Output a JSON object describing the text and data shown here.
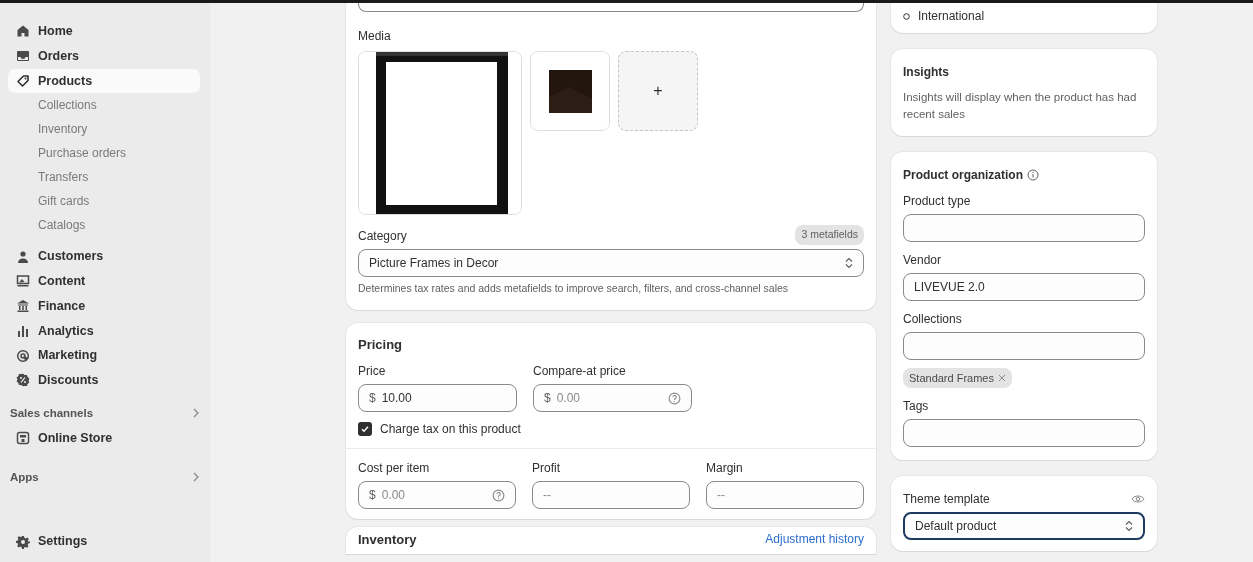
{
  "sidebar": {
    "items": [
      {
        "label": "Home",
        "selected": false
      },
      {
        "label": "Orders",
        "selected": false
      },
      {
        "label": "Products",
        "selected": true,
        "children": [
          {
            "label": "Collections"
          },
          {
            "label": "Inventory"
          },
          {
            "label": "Purchase orders"
          },
          {
            "label": "Transfers"
          },
          {
            "label": "Gift cards"
          },
          {
            "label": "Catalogs"
          }
        ]
      },
      {
        "label": "Customers",
        "selected": false
      },
      {
        "label": "Content",
        "selected": false
      },
      {
        "label": "Finance",
        "selected": false
      },
      {
        "label": "Analytics",
        "selected": false
      },
      {
        "label": "Marketing",
        "selected": false
      },
      {
        "label": "Discounts",
        "selected": false
      }
    ],
    "sections": [
      {
        "title": "Sales channels",
        "items": [
          {
            "label": "Online Store",
            "selected": false
          }
        ]
      },
      {
        "title": "Apps"
      }
    ],
    "settings": {
      "label": "Settings"
    }
  },
  "main": {
    "media": {
      "title": "Media",
      "items": [
        {
          "kind": "picture"
        },
        {
          "kind": "picture"
        },
        {
          "kind": "add",
          "label": "+"
        }
      ],
      "category": {
        "label": "Category",
        "badge": "3 metafields",
        "value": "Picture Frames in Decor",
        "help": "Determines tax rates and adds metafields to improve search, filters, and cross-channel sales"
      }
    },
    "pricing": {
      "title": "Pricing",
      "fields": [
        {
          "label": "Price",
          "prefix": "$",
          "value": "10.00",
          "help_icon": false
        },
        {
          "label": "Compare-at price",
          "prefix": "$",
          "placeholder": "0.00",
          "help_icon": true
        }
      ],
      "charge_tax": {
        "label": "Charge tax on this product",
        "checked": true
      },
      "cost_fields": [
        {
          "label": "Cost per item",
          "prefix": "$",
          "placeholder": "0.00",
          "help_icon": true
        },
        {
          "label": "Profit",
          "placeholder": "--",
          "help_icon": false
        },
        {
          "label": "Margin",
          "placeholder": "--",
          "help_icon": false
        }
      ]
    },
    "inventory": {
      "title": "Inventory",
      "link": "Adjustment history"
    }
  },
  "right": {
    "markets": {
      "items": [
        "International"
      ]
    },
    "insights": {
      "title": "Insights",
      "text": "Insights will display when the product has had recent sales"
    },
    "organization": {
      "title": "Product organization",
      "fields": [
        {
          "label": "Product type"
        },
        {
          "label": "Vendor",
          "value": "LIVEVUE 2.0"
        },
        {
          "label": "Collections",
          "chips": [
            "Standard Frames"
          ]
        },
        {
          "label": "Tags"
        }
      ]
    },
    "theme": {
      "label": "Theme template",
      "value": "Default product"
    }
  }
}
